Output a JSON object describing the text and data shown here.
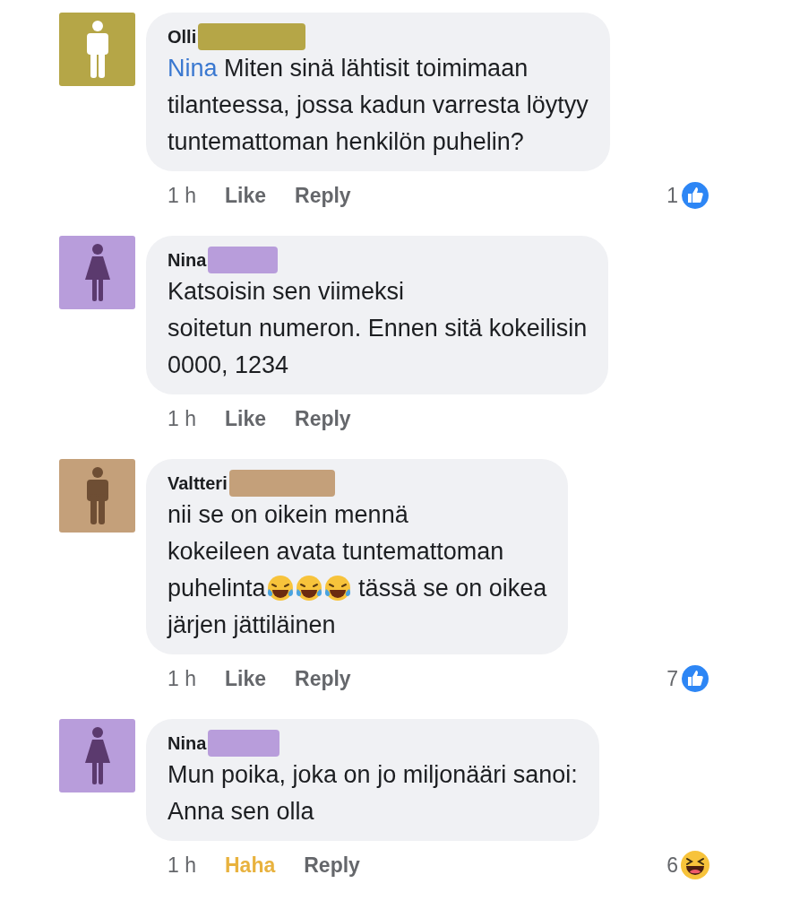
{
  "comments": [
    {
      "author": "Olli",
      "redaction": {
        "color": "#b5a647"
      },
      "avatar": {
        "color": "#b5a647",
        "figure": {
          "kind": "man",
          "color": "#ffffff"
        }
      },
      "lines": [
        [
          {
            "kind": "mention",
            "text": "Nina"
          },
          {
            "kind": "text",
            "text": " Miten sinä lähtisit toimimaan"
          }
        ],
        [
          {
            "kind": "text",
            "text": "tilanteessa, jossa kadun varresta löytyy"
          }
        ],
        [
          {
            "kind": "text",
            "text": "tuntemattoman henkilön puhelin?"
          }
        ]
      ],
      "time": "1 h",
      "react": {
        "label": "Like",
        "selected": false
      },
      "reply": "Reply",
      "reactions": {
        "count": "1",
        "kind": "like"
      }
    },
    {
      "author": "Nina",
      "redaction": {
        "color": "#b89ddb"
      },
      "avatar": {
        "color": "#b89ddb",
        "figure": {
          "kind": "woman",
          "color": "#5b3a6e"
        }
      },
      "lines": [
        [
          {
            "kind": "text",
            "text": "Katsoisin sen viimeksi"
          }
        ],
        [
          {
            "kind": "text",
            "text": "soitetun numeron. Ennen sitä kokeilisin"
          }
        ],
        [
          {
            "kind": "text",
            "text": "0000, 1234"
          }
        ]
      ],
      "time": "1 h",
      "react": {
        "label": "Like",
        "selected": false
      },
      "reply": "Reply"
    },
    {
      "author": "Valtteri",
      "redaction": {
        "color": "#c4a07a"
      },
      "avatar": {
        "color": "#c4a07a",
        "figure": {
          "kind": "man",
          "color": "#6e4e34"
        }
      },
      "lines": [
        [
          {
            "kind": "text",
            "text": "nii se on oikein mennä"
          }
        ],
        [
          {
            "kind": "text",
            "text": "kokeileen avata tuntemattoman"
          }
        ],
        [
          {
            "kind": "text",
            "text": "puhelinta"
          },
          {
            "kind": "emoji"
          },
          {
            "kind": "emoji"
          },
          {
            "kind": "emoji"
          },
          {
            "kind": "text",
            "text": " tässä se on oikea"
          }
        ],
        [
          {
            "kind": "text",
            "text": "järjen jättiläinen"
          }
        ]
      ],
      "time": "1 h",
      "react": {
        "label": "Like",
        "selected": false
      },
      "reply": "Reply",
      "reactions": {
        "count": "7",
        "kind": "like"
      }
    },
    {
      "author": "Nina",
      "redaction": {
        "color": "#b89ddb"
      },
      "avatar": {
        "color": "#b89ddb",
        "figure": {
          "kind": "woman",
          "color": "#5b3a6e"
        }
      },
      "lines": [
        [
          {
            "kind": "text",
            "text": "Mun poika, joka on jo miljonääri sanoi:"
          }
        ],
        [
          {
            "kind": "text",
            "text": "Anna sen olla"
          }
        ]
      ],
      "time": "1 h",
      "react": {
        "label": "Haha",
        "selected": true
      },
      "reply": "Reply",
      "reactions": {
        "count": "6",
        "kind": "haha"
      }
    }
  ]
}
